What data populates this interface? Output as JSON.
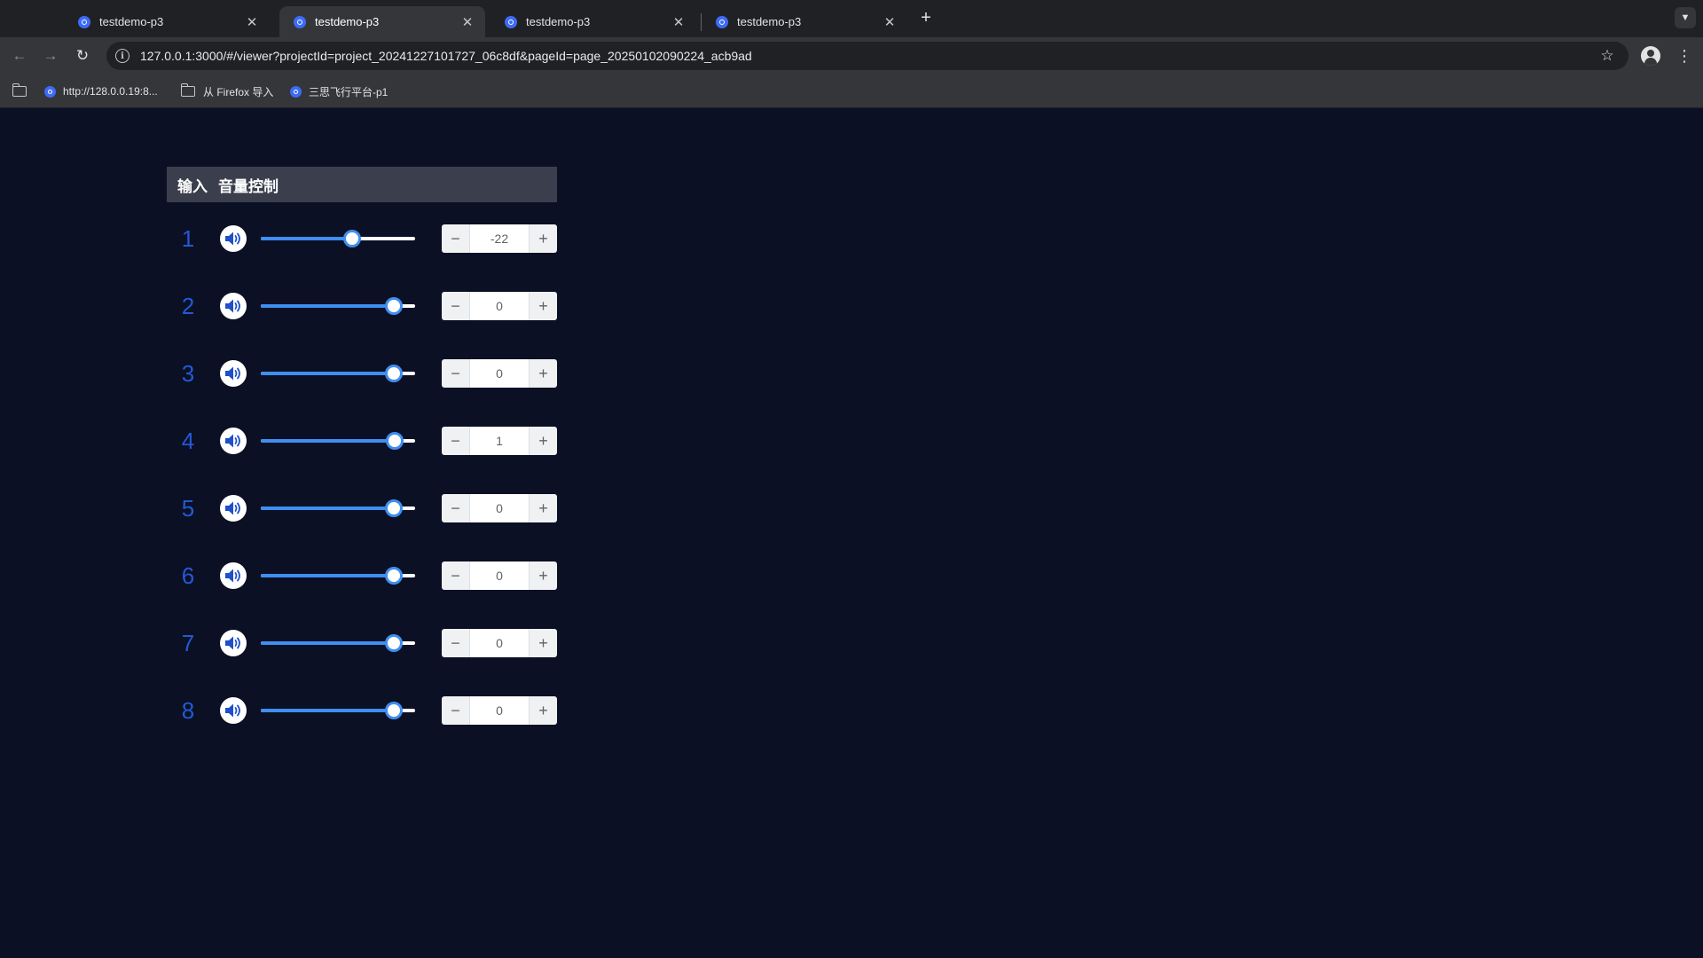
{
  "browser": {
    "tabs": [
      {
        "title": "testdemo-p3",
        "active": false
      },
      {
        "title": "testdemo-p3",
        "active": true
      },
      {
        "title": "testdemo-p3",
        "active": false
      },
      {
        "title": "testdemo-p3",
        "active": false
      }
    ],
    "close_glyph": "✕",
    "new_tab_glyph": "+",
    "url": "127.0.0.1:3000/#/viewer?projectId=project_20241227101727_06c8df&pageId=page_20250102090224_acb9ad",
    "bookmarks": [
      {
        "label": "http://128.0.0.19:8...",
        "icon": "globe-icon"
      },
      {
        "label": "从 Firefox 导入",
        "icon": "folder-icon"
      },
      {
        "label": "三思飞行平台-p1",
        "icon": "globe-icon"
      }
    ]
  },
  "panel": {
    "title": "输入",
    "subtitle": "音量控制"
  },
  "channels": [
    {
      "number": "1",
      "value": "-22",
      "level": 0.59
    },
    {
      "number": "2",
      "value": "0",
      "level": 0.86
    },
    {
      "number": "3",
      "value": "0",
      "level": 0.86
    },
    {
      "number": "4",
      "value": "1",
      "level": 0.87
    },
    {
      "number": "5",
      "value": "0",
      "level": 0.86
    },
    {
      "number": "6",
      "value": "0",
      "level": 0.86
    },
    {
      "number": "7",
      "value": "0",
      "level": 0.86
    },
    {
      "number": "8",
      "value": "0",
      "level": 0.86
    }
  ],
  "stepper": {
    "minus": "−",
    "plus": "+"
  },
  "colors": {
    "accent": "#3f8ef0",
    "channel_number": "#2459d6",
    "page_background": "#0b1024"
  }
}
